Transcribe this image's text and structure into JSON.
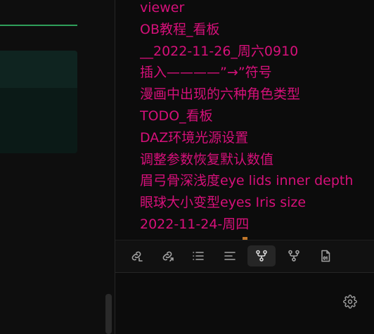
{
  "outgoing_links": {
    "items": [
      {
        "label": "viewer"
      },
      {
        "label": "OB教程_看板"
      },
      {
        "label": "__2022-11-26_周六0910"
      },
      {
        "label": "插入————”→”符号"
      },
      {
        "label": "漫画中出现的六种角色类型"
      },
      {
        "label": "TODO_看板"
      },
      {
        "label": "DAZ环境光源设置"
      },
      {
        "label": "调整参数恢复默认数值"
      },
      {
        "label": "眉弓骨深浅度eye lids inner depth"
      },
      {
        "label": "眼球大小变型eyes Iris size"
      },
      {
        "label": "2022-11-24-周四"
      }
    ]
  },
  "toolbar": {
    "buttons": [
      {
        "icon": "backlinks-icon"
      },
      {
        "icon": "outgoing-links-icon"
      },
      {
        "icon": "list-icon"
      },
      {
        "icon": "outline-icon"
      },
      {
        "icon": "graph-icon",
        "active": true
      },
      {
        "icon": "local-graph-icon"
      },
      {
        "icon": "file-binary-icon"
      }
    ]
  },
  "settings": {
    "icon": "gear-icon"
  },
  "colors": {
    "link_text": "#d6107a",
    "icon": "#a3a3a3",
    "accent_green": "#2e9e5a",
    "background": "#0c0c0c"
  }
}
